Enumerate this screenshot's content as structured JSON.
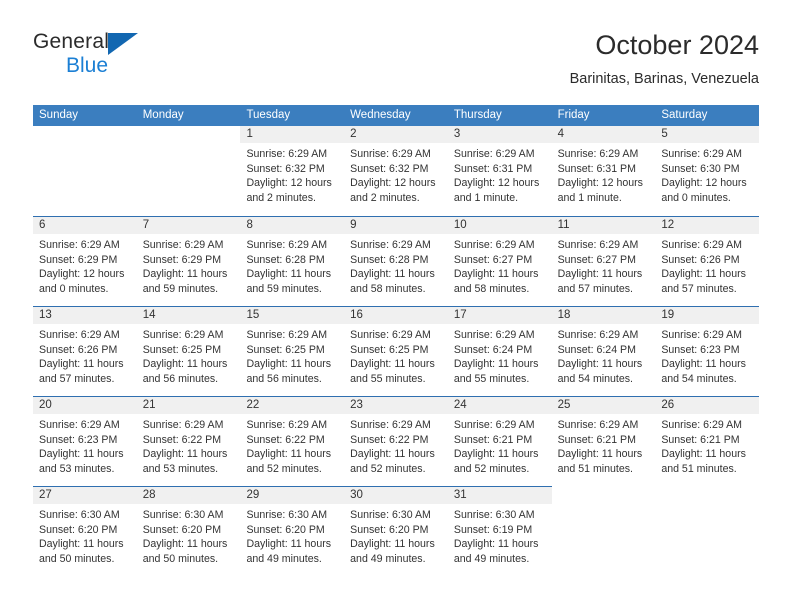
{
  "brand": {
    "name_part1": "General",
    "name_part2": "Blue",
    "triangle_color": "#1267b1",
    "blue_color": "#1b7fd4"
  },
  "header": {
    "title": "October 2024",
    "subtitle": "Barinitas, Barinas, Venezuela"
  },
  "theme": {
    "header_row_bg": "#3b7ebf",
    "day_number_bg": "#f0f0f0",
    "row_separator": "#2f6fb0",
    "text": "#333333"
  },
  "weekdays": [
    "Sunday",
    "Monday",
    "Tuesday",
    "Wednesday",
    "Thursday",
    "Friday",
    "Saturday"
  ],
  "labels": {
    "sunrise_prefix": "Sunrise:",
    "sunset_prefix": "Sunset:",
    "daylight_prefix": "Daylight:"
  },
  "weeks": [
    [
      {
        "empty": true
      },
      {
        "empty": true
      },
      {
        "day": "1",
        "sunrise": "Sunrise: 6:29 AM",
        "sunset": "Sunset: 6:32 PM",
        "daylight": "Daylight: 12 hours and 2 minutes."
      },
      {
        "day": "2",
        "sunrise": "Sunrise: 6:29 AM",
        "sunset": "Sunset: 6:32 PM",
        "daylight": "Daylight: 12 hours and 2 minutes."
      },
      {
        "day": "3",
        "sunrise": "Sunrise: 6:29 AM",
        "sunset": "Sunset: 6:31 PM",
        "daylight": "Daylight: 12 hours and 1 minute."
      },
      {
        "day": "4",
        "sunrise": "Sunrise: 6:29 AM",
        "sunset": "Sunset: 6:31 PM",
        "daylight": "Daylight: 12 hours and 1 minute."
      },
      {
        "day": "5",
        "sunrise": "Sunrise: 6:29 AM",
        "sunset": "Sunset: 6:30 PM",
        "daylight": "Daylight: 12 hours and 0 minutes."
      }
    ],
    [
      {
        "day": "6",
        "sunrise": "Sunrise: 6:29 AM",
        "sunset": "Sunset: 6:29 PM",
        "daylight": "Daylight: 12 hours and 0 minutes."
      },
      {
        "day": "7",
        "sunrise": "Sunrise: 6:29 AM",
        "sunset": "Sunset: 6:29 PM",
        "daylight": "Daylight: 11 hours and 59 minutes."
      },
      {
        "day": "8",
        "sunrise": "Sunrise: 6:29 AM",
        "sunset": "Sunset: 6:28 PM",
        "daylight": "Daylight: 11 hours and 59 minutes."
      },
      {
        "day": "9",
        "sunrise": "Sunrise: 6:29 AM",
        "sunset": "Sunset: 6:28 PM",
        "daylight": "Daylight: 11 hours and 58 minutes."
      },
      {
        "day": "10",
        "sunrise": "Sunrise: 6:29 AM",
        "sunset": "Sunset: 6:27 PM",
        "daylight": "Daylight: 11 hours and 58 minutes."
      },
      {
        "day": "11",
        "sunrise": "Sunrise: 6:29 AM",
        "sunset": "Sunset: 6:27 PM",
        "daylight": "Daylight: 11 hours and 57 minutes."
      },
      {
        "day": "12",
        "sunrise": "Sunrise: 6:29 AM",
        "sunset": "Sunset: 6:26 PM",
        "daylight": "Daylight: 11 hours and 57 minutes."
      }
    ],
    [
      {
        "day": "13",
        "sunrise": "Sunrise: 6:29 AM",
        "sunset": "Sunset: 6:26 PM",
        "daylight": "Daylight: 11 hours and 57 minutes."
      },
      {
        "day": "14",
        "sunrise": "Sunrise: 6:29 AM",
        "sunset": "Sunset: 6:25 PM",
        "daylight": "Daylight: 11 hours and 56 minutes."
      },
      {
        "day": "15",
        "sunrise": "Sunrise: 6:29 AM",
        "sunset": "Sunset: 6:25 PM",
        "daylight": "Daylight: 11 hours and 56 minutes."
      },
      {
        "day": "16",
        "sunrise": "Sunrise: 6:29 AM",
        "sunset": "Sunset: 6:25 PM",
        "daylight": "Daylight: 11 hours and 55 minutes."
      },
      {
        "day": "17",
        "sunrise": "Sunrise: 6:29 AM",
        "sunset": "Sunset: 6:24 PM",
        "daylight": "Daylight: 11 hours and 55 minutes."
      },
      {
        "day": "18",
        "sunrise": "Sunrise: 6:29 AM",
        "sunset": "Sunset: 6:24 PM",
        "daylight": "Daylight: 11 hours and 54 minutes."
      },
      {
        "day": "19",
        "sunrise": "Sunrise: 6:29 AM",
        "sunset": "Sunset: 6:23 PM",
        "daylight": "Daylight: 11 hours and 54 minutes."
      }
    ],
    [
      {
        "day": "20",
        "sunrise": "Sunrise: 6:29 AM",
        "sunset": "Sunset: 6:23 PM",
        "daylight": "Daylight: 11 hours and 53 minutes."
      },
      {
        "day": "21",
        "sunrise": "Sunrise: 6:29 AM",
        "sunset": "Sunset: 6:22 PM",
        "daylight": "Daylight: 11 hours and 53 minutes."
      },
      {
        "day": "22",
        "sunrise": "Sunrise: 6:29 AM",
        "sunset": "Sunset: 6:22 PM",
        "daylight": "Daylight: 11 hours and 52 minutes."
      },
      {
        "day": "23",
        "sunrise": "Sunrise: 6:29 AM",
        "sunset": "Sunset: 6:22 PM",
        "daylight": "Daylight: 11 hours and 52 minutes."
      },
      {
        "day": "24",
        "sunrise": "Sunrise: 6:29 AM",
        "sunset": "Sunset: 6:21 PM",
        "daylight": "Daylight: 11 hours and 52 minutes."
      },
      {
        "day": "25",
        "sunrise": "Sunrise: 6:29 AM",
        "sunset": "Sunset: 6:21 PM",
        "daylight": "Daylight: 11 hours and 51 minutes."
      },
      {
        "day": "26",
        "sunrise": "Sunrise: 6:29 AM",
        "sunset": "Sunset: 6:21 PM",
        "daylight": "Daylight: 11 hours and 51 minutes."
      }
    ],
    [
      {
        "day": "27",
        "sunrise": "Sunrise: 6:30 AM",
        "sunset": "Sunset: 6:20 PM",
        "daylight": "Daylight: 11 hours and 50 minutes."
      },
      {
        "day": "28",
        "sunrise": "Sunrise: 6:30 AM",
        "sunset": "Sunset: 6:20 PM",
        "daylight": "Daylight: 11 hours and 50 minutes."
      },
      {
        "day": "29",
        "sunrise": "Sunrise: 6:30 AM",
        "sunset": "Sunset: 6:20 PM",
        "daylight": "Daylight: 11 hours and 49 minutes."
      },
      {
        "day": "30",
        "sunrise": "Sunrise: 6:30 AM",
        "sunset": "Sunset: 6:20 PM",
        "daylight": "Daylight: 11 hours and 49 minutes."
      },
      {
        "day": "31",
        "sunrise": "Sunrise: 6:30 AM",
        "sunset": "Sunset: 6:19 PM",
        "daylight": "Daylight: 11 hours and 49 minutes."
      },
      {
        "empty": true
      },
      {
        "empty": true
      }
    ]
  ]
}
